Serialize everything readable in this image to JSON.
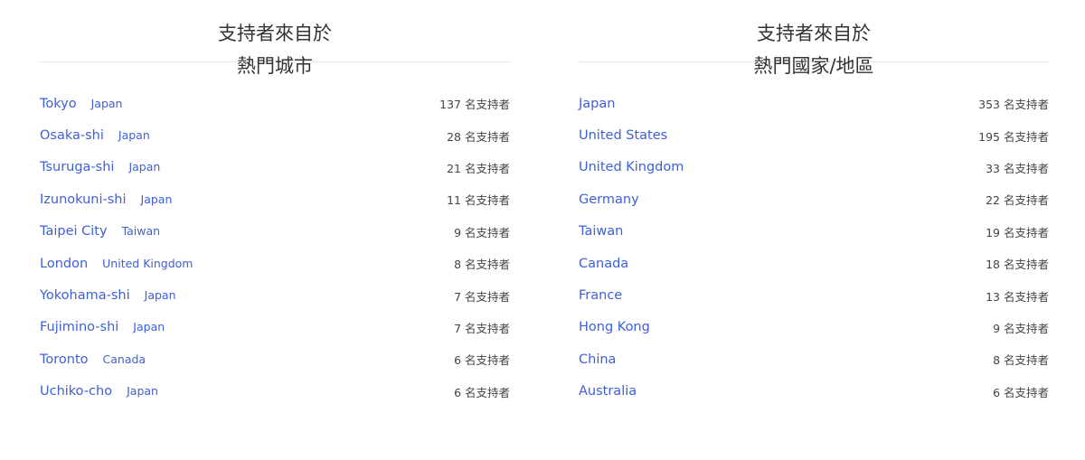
{
  "cities": {
    "title_line1": "支持者來自於",
    "title_line2": "熱門城市",
    "items": [
      {
        "name": "Tokyo",
        "country": "Japan",
        "count": "137 名支持者"
      },
      {
        "name": "Osaka-shi",
        "country": "Japan",
        "count": "28 名支持者"
      },
      {
        "name": "Tsuruga-shi",
        "country": "Japan",
        "count": "21 名支持者"
      },
      {
        "name": "Izunokuni-shi",
        "country": "Japan",
        "count": "11 名支持者"
      },
      {
        "name": "Taipei City",
        "country": "Taiwan",
        "count": "9 名支持者"
      },
      {
        "name": "London",
        "country": "United Kingdom",
        "count": "8 名支持者"
      },
      {
        "name": "Yokohama-shi",
        "country": "Japan",
        "count": "7 名支持者"
      },
      {
        "name": "Fujimino-shi",
        "country": "Japan",
        "count": "7 名支持者"
      },
      {
        "name": "Toronto",
        "country": "Canada",
        "count": "6 名支持者"
      },
      {
        "name": "Uchiko-cho",
        "country": "Japan",
        "count": "6 名支持者"
      }
    ]
  },
  "countries": {
    "title_line1": "支持者來自於",
    "title_line2": "熱門國家/地區",
    "items": [
      {
        "name": "Japan",
        "count": "353 名支持者"
      },
      {
        "name": "United States",
        "count": "195 名支持者"
      },
      {
        "name": "United Kingdom",
        "count": "33 名支持者"
      },
      {
        "name": "Germany",
        "count": "22 名支持者"
      },
      {
        "name": "Taiwan",
        "count": "19 名支持者"
      },
      {
        "name": "Canada",
        "count": "18 名支持者"
      },
      {
        "name": "France",
        "count": "13 名支持者"
      },
      {
        "name": "Hong Kong",
        "count": "9 名支持者"
      },
      {
        "name": "China",
        "count": "8 名支持者"
      },
      {
        "name": "Australia",
        "count": "6 名支持者"
      }
    ]
  },
  "colors": {
    "link": "#3e5fd6",
    "text": "#333333",
    "divider": "#e6e6e6"
  }
}
